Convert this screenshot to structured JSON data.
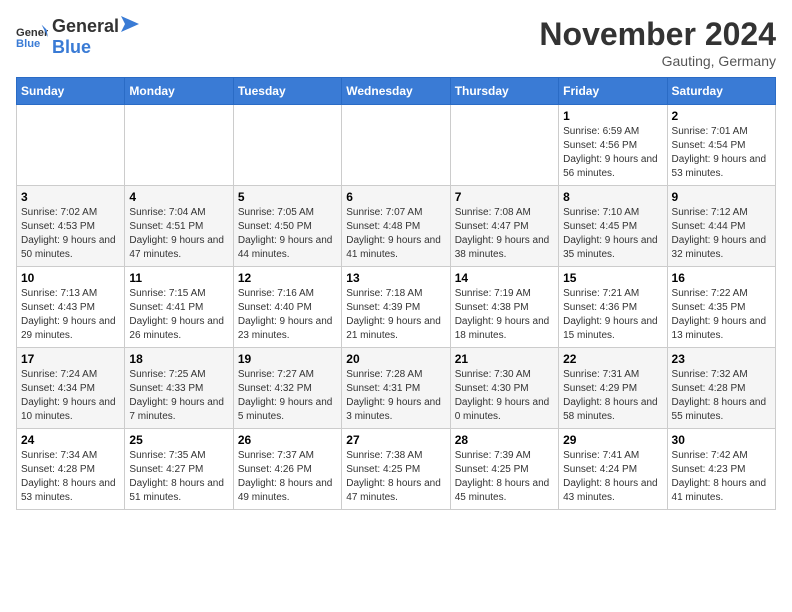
{
  "header": {
    "logo_general": "General",
    "logo_blue": "Blue",
    "month_title": "November 2024",
    "location": "Gauting, Germany"
  },
  "days_of_week": [
    "Sunday",
    "Monday",
    "Tuesday",
    "Wednesday",
    "Thursday",
    "Friday",
    "Saturday"
  ],
  "weeks": [
    [
      {
        "day": "",
        "info": ""
      },
      {
        "day": "",
        "info": ""
      },
      {
        "day": "",
        "info": ""
      },
      {
        "day": "",
        "info": ""
      },
      {
        "day": "",
        "info": ""
      },
      {
        "day": "1",
        "info": "Sunrise: 6:59 AM\nSunset: 4:56 PM\nDaylight: 9 hours and 56 minutes."
      },
      {
        "day": "2",
        "info": "Sunrise: 7:01 AM\nSunset: 4:54 PM\nDaylight: 9 hours and 53 minutes."
      }
    ],
    [
      {
        "day": "3",
        "info": "Sunrise: 7:02 AM\nSunset: 4:53 PM\nDaylight: 9 hours and 50 minutes."
      },
      {
        "day": "4",
        "info": "Sunrise: 7:04 AM\nSunset: 4:51 PM\nDaylight: 9 hours and 47 minutes."
      },
      {
        "day": "5",
        "info": "Sunrise: 7:05 AM\nSunset: 4:50 PM\nDaylight: 9 hours and 44 minutes."
      },
      {
        "day": "6",
        "info": "Sunrise: 7:07 AM\nSunset: 4:48 PM\nDaylight: 9 hours and 41 minutes."
      },
      {
        "day": "7",
        "info": "Sunrise: 7:08 AM\nSunset: 4:47 PM\nDaylight: 9 hours and 38 minutes."
      },
      {
        "day": "8",
        "info": "Sunrise: 7:10 AM\nSunset: 4:45 PM\nDaylight: 9 hours and 35 minutes."
      },
      {
        "day": "9",
        "info": "Sunrise: 7:12 AM\nSunset: 4:44 PM\nDaylight: 9 hours and 32 minutes."
      }
    ],
    [
      {
        "day": "10",
        "info": "Sunrise: 7:13 AM\nSunset: 4:43 PM\nDaylight: 9 hours and 29 minutes."
      },
      {
        "day": "11",
        "info": "Sunrise: 7:15 AM\nSunset: 4:41 PM\nDaylight: 9 hours and 26 minutes."
      },
      {
        "day": "12",
        "info": "Sunrise: 7:16 AM\nSunset: 4:40 PM\nDaylight: 9 hours and 23 minutes."
      },
      {
        "day": "13",
        "info": "Sunrise: 7:18 AM\nSunset: 4:39 PM\nDaylight: 9 hours and 21 minutes."
      },
      {
        "day": "14",
        "info": "Sunrise: 7:19 AM\nSunset: 4:38 PM\nDaylight: 9 hours and 18 minutes."
      },
      {
        "day": "15",
        "info": "Sunrise: 7:21 AM\nSunset: 4:36 PM\nDaylight: 9 hours and 15 minutes."
      },
      {
        "day": "16",
        "info": "Sunrise: 7:22 AM\nSunset: 4:35 PM\nDaylight: 9 hours and 13 minutes."
      }
    ],
    [
      {
        "day": "17",
        "info": "Sunrise: 7:24 AM\nSunset: 4:34 PM\nDaylight: 9 hours and 10 minutes."
      },
      {
        "day": "18",
        "info": "Sunrise: 7:25 AM\nSunset: 4:33 PM\nDaylight: 9 hours and 7 minutes."
      },
      {
        "day": "19",
        "info": "Sunrise: 7:27 AM\nSunset: 4:32 PM\nDaylight: 9 hours and 5 minutes."
      },
      {
        "day": "20",
        "info": "Sunrise: 7:28 AM\nSunset: 4:31 PM\nDaylight: 9 hours and 3 minutes."
      },
      {
        "day": "21",
        "info": "Sunrise: 7:30 AM\nSunset: 4:30 PM\nDaylight: 9 hours and 0 minutes."
      },
      {
        "day": "22",
        "info": "Sunrise: 7:31 AM\nSunset: 4:29 PM\nDaylight: 8 hours and 58 minutes."
      },
      {
        "day": "23",
        "info": "Sunrise: 7:32 AM\nSunset: 4:28 PM\nDaylight: 8 hours and 55 minutes."
      }
    ],
    [
      {
        "day": "24",
        "info": "Sunrise: 7:34 AM\nSunset: 4:28 PM\nDaylight: 8 hours and 53 minutes."
      },
      {
        "day": "25",
        "info": "Sunrise: 7:35 AM\nSunset: 4:27 PM\nDaylight: 8 hours and 51 minutes."
      },
      {
        "day": "26",
        "info": "Sunrise: 7:37 AM\nSunset: 4:26 PM\nDaylight: 8 hours and 49 minutes."
      },
      {
        "day": "27",
        "info": "Sunrise: 7:38 AM\nSunset: 4:25 PM\nDaylight: 8 hours and 47 minutes."
      },
      {
        "day": "28",
        "info": "Sunrise: 7:39 AM\nSunset: 4:25 PM\nDaylight: 8 hours and 45 minutes."
      },
      {
        "day": "29",
        "info": "Sunrise: 7:41 AM\nSunset: 4:24 PM\nDaylight: 8 hours and 43 minutes."
      },
      {
        "day": "30",
        "info": "Sunrise: 7:42 AM\nSunset: 4:23 PM\nDaylight: 8 hours and 41 minutes."
      }
    ]
  ]
}
